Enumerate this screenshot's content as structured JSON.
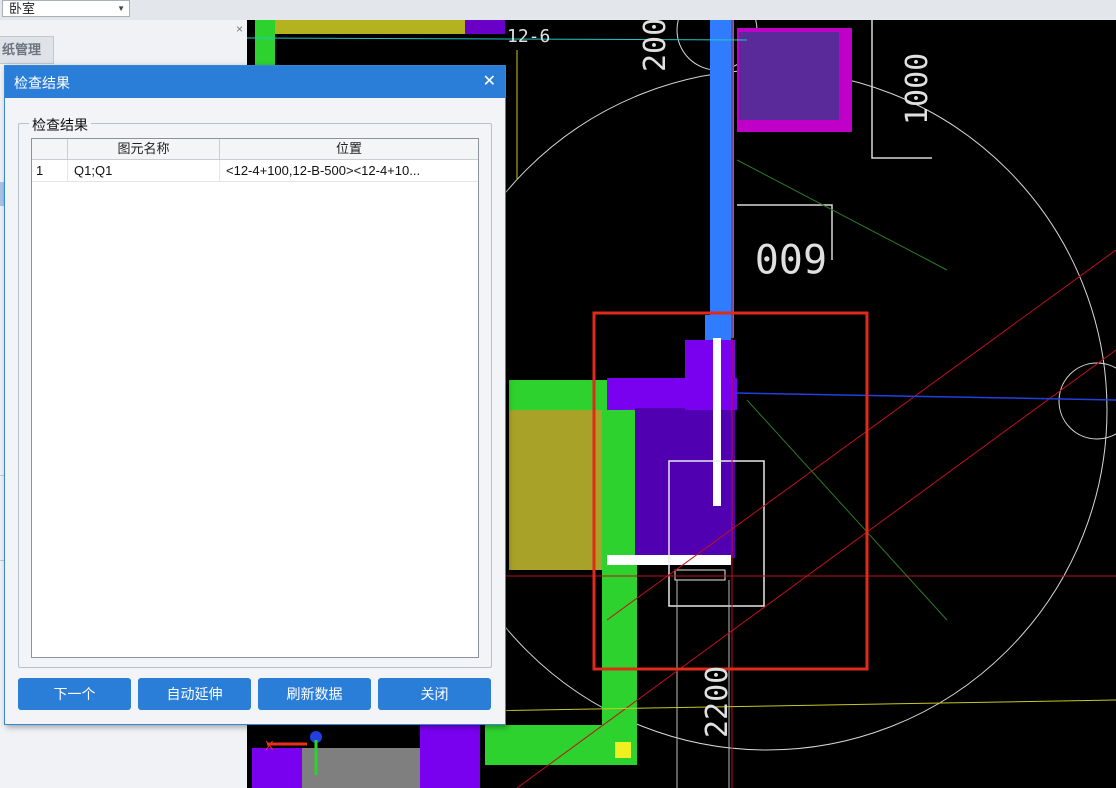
{
  "toolbar": {
    "room_select_value": "卧室"
  },
  "left_panel": {
    "drawing_tab_label": "纸管理"
  },
  "dialog": {
    "title": "检查结果",
    "group_label": "检查结果",
    "table": {
      "headers": [
        "",
        "图元名称",
        "位置"
      ],
      "rows": [
        {
          "index": "1",
          "name": "Q1;Q1",
          "position": "<12-4+100,12-B-500><12-4+10..."
        }
      ]
    },
    "buttons": {
      "next": "下一个",
      "auto_extend": "自动延伸",
      "refresh": "刷新数据",
      "close": "关闭"
    }
  },
  "cad": {
    "dimensions": [
      "12-6",
      "200",
      "1000",
      "600",
      "2200"
    ],
    "axis_label": "X"
  },
  "colors": {
    "dialog_accent": "#2b7ed8",
    "highlight_box": "#e02a1a",
    "wall_green": "#2ed22e",
    "wall_purple": "#6a00c8"
  }
}
